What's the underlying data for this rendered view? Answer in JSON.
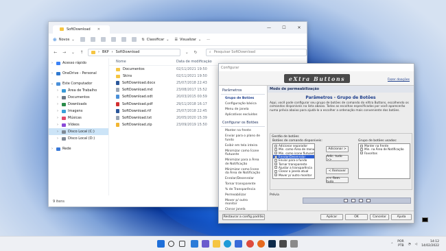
{
  "explorer": {
    "title": "SoftDownload",
    "ribbon": {
      "new": "Novos",
      "sort": "Classificar",
      "view": "Visualizar",
      "more": "···"
    },
    "address": {
      "root": "BKP",
      "folder": "SoftDownload"
    },
    "search_placeholder": "Pesquisar SoftDownload",
    "sidebar": [
      {
        "label": "Acesso rápido",
        "icon": "star-icon",
        "color": "#3b82f6",
        "level": 0,
        "arrow": ">"
      },
      {
        "label": "OneDrive - Personal",
        "icon": "cloud-icon",
        "color": "#2f79d0",
        "level": 0,
        "arrow": ">"
      },
      {
        "label": "Este Computador",
        "icon": "computer-icon",
        "color": "#4a90d9",
        "level": 0,
        "arrow": "v"
      },
      {
        "label": "Área de Trabalho",
        "icon": "desktop-icon",
        "color": "#3a9ad8",
        "level": 1,
        "arrow": ">"
      },
      {
        "label": "Documentos",
        "icon": "documents-icon",
        "color": "#6b7785",
        "level": 1,
        "arrow": ">"
      },
      {
        "label": "Downloads",
        "icon": "download-icon",
        "color": "#2a8c4a",
        "level": 1,
        "arrow": ">"
      },
      {
        "label": "Imagens",
        "icon": "images-icon",
        "color": "#3aa0d8",
        "level": 1,
        "arrow": ">"
      },
      {
        "label": "Músicas",
        "icon": "music-icon",
        "color": "#e24a6a",
        "level": 1,
        "arrow": ">"
      },
      {
        "label": "Vídeos",
        "icon": "video-icon",
        "color": "#8a4ad8",
        "level": 1,
        "arrow": ">"
      },
      {
        "label": "Disco Local (C:)",
        "icon": "drive-icon",
        "color": "#7f8a96",
        "level": 1,
        "arrow": ">",
        "selected": true
      },
      {
        "label": "Disco Local (D:)",
        "icon": "drive-icon",
        "color": "#7f8a96",
        "level": 1,
        "arrow": ">"
      },
      {
        "label": "Rede",
        "icon": "network-icon",
        "color": "#3a7ad8",
        "level": 0,
        "arrow": ">"
      }
    ],
    "columns": {
      "name": "Nome",
      "date": "Data de modificação"
    },
    "files": [
      {
        "name": "Documentos",
        "date": "02/11/2021 19:50",
        "icon": "folder-icon",
        "color": "#f5c542"
      },
      {
        "name": "Skins",
        "date": "02/11/2021 19:50",
        "icon": "folder-icon",
        "color": "#f5c542"
      },
      {
        "name": "SoftDownload.docx",
        "date": "25/07/2018 22:43",
        "icon": "word-icon",
        "color": "#2b579a"
      },
      {
        "name": "SoftDownload.md",
        "date": "23/08/2017 15:52",
        "icon": "text-icon",
        "color": "#9aa5b4"
      },
      {
        "name": "SoftDownload.odt",
        "date": "20/03/2015 00:59",
        "icon": "odt-icon",
        "color": "#4a90d9"
      },
      {
        "name": "SoftDownload.pdf",
        "date": "29/11/2018 16:17",
        "icon": "pdf-icon",
        "color": "#d32f2f"
      },
      {
        "name": "SoftDownload.rtf",
        "date": "25/07/2018 22:45",
        "icon": "rtf-icon",
        "color": "#2b579a"
      },
      {
        "name": "SoftDownload.txt",
        "date": "20/05/2020 15:39",
        "icon": "text-icon",
        "color": "#9aa5b4"
      },
      {
        "name": "SoftDownload.zip",
        "date": "23/09/2019 15:50",
        "icon": "zip-icon",
        "color": "#f2b632"
      }
    ],
    "status": "9 itens"
  },
  "config": {
    "title": "Configurar",
    "logo": "eXtra Buttons",
    "donate": "Fazer doações",
    "left": {
      "group1": "Parâmetros",
      "items1": [
        "Grupo de Botões",
        "Configuração básica",
        "Menu de janela",
        "Aplicativos excluídos"
      ],
      "group2": "Configurar os Botões",
      "items2": [
        "Manter na frente",
        "Enviar para o plano de fundo",
        "Exibir em tela inteira",
        "Minimizar como Ícone flutuante",
        "Minimizar para a Área de Notificação",
        "Minimizar como Ícone da Área de Notificação",
        "Enrolar/Desenrolar",
        "Tornar transparente",
        "% de Transparência",
        "Permeabilizar",
        "Mover p/ outro monitor",
        "Clonar janela"
      ]
    },
    "mode_head": "Modo de permeabilização",
    "params_title": "Parâmetros - Grupo de Botões",
    "description": "Aqui, você pode configurar seu grupo de botões de comando do eXtra Buttons, escolhendo os comandos disponíveis na lista abaixo. Todas as escolhas especificadas por você aparecerão numa prévia abaixo para ajudá-lo a escolher a ordenação mais conveniente dos botões.",
    "gestao": "Gestão de botões",
    "available_label": "Botões de comando disponíveis:",
    "available": [
      "Adicionar separador",
      "Min. como Área de menu",
      "Min. como ícone flutuante",
      "Enrolar/Desenrolar",
      "Enviar para o fundo",
      "Tornar transparente",
      "Ajustar a transparência",
      "Clonar a janela atual",
      "Mover p/ outro monitor"
    ],
    "selected_available": "Enrolar/Desenrolar",
    "used_label": "Grupo de botões usados:",
    "used": [
      "Manter na frente",
      "Min. na Área de Notificação",
      "Favoritos"
    ],
    "buttons": {
      "add": "Adicionar >",
      "add_all": "Adic. tudo >>",
      "remove": "< Remover",
      "remove_all": "<< Rem. tudo"
    },
    "preview_label": "Prévia",
    "color_label": "Cor dos botões do eXtra Buttons",
    "radio_auto": "Escolha automática",
    "radio_manual": "Manual",
    "footer": {
      "restore": "Restaurar a config padrão",
      "apply": "Aplicar",
      "ok": "OK",
      "cancel": "Cancelar",
      "help": "Ajuda"
    }
  },
  "taskbar": {
    "lang": "POR",
    "kbd": "PTB",
    "time": "14:12",
    "date": "14/02/2022",
    "icons": [
      {
        "name": "start-icon",
        "color": "#1e6fd9"
      },
      {
        "name": "search-icon",
        "color": "#333333"
      },
      {
        "name": "taskview-icon",
        "color": "#444444"
      },
      {
        "name": "widgets-icon",
        "color": "#2a7bd8"
      },
      {
        "name": "chat-icon",
        "color": "#6a5acd"
      },
      {
        "name": "explorer-icon",
        "color": "#f5c542"
      },
      {
        "name": "edge-icon",
        "color": "#1f9bd8"
      },
      {
        "name": "store-icon",
        "color": "#3a6ad8"
      },
      {
        "name": "chrome-icon",
        "color": "#dd4b3e"
      },
      {
        "name": "firefox-icon",
        "color": "#e66a1e"
      },
      {
        "name": "photoshop-icon",
        "color": "#0d2a4a"
      },
      {
        "name": "extrabuttons-icon",
        "color": "#4a4a4a"
      },
      {
        "name": "app-icon",
        "color": "#8a8a8a"
      }
    ]
  }
}
